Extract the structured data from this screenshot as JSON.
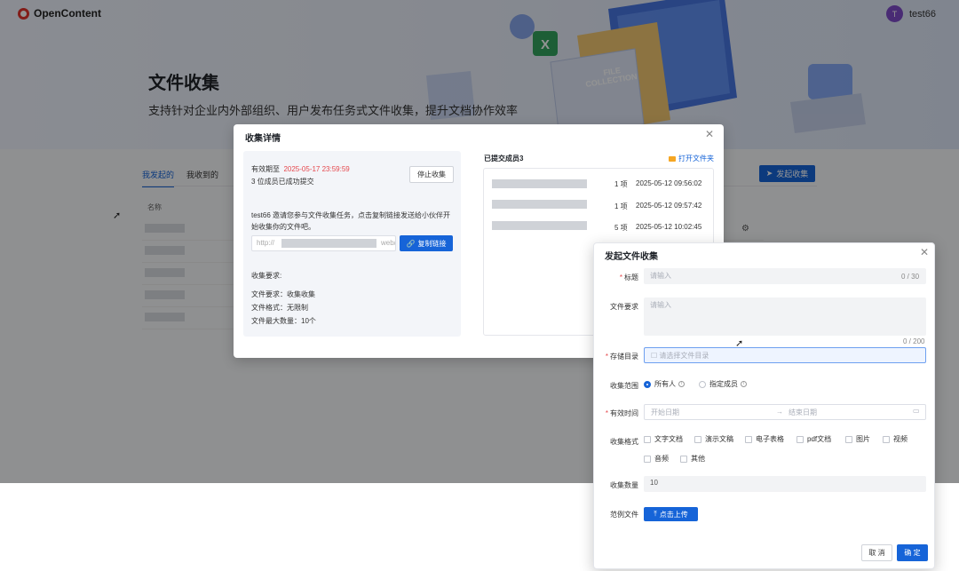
{
  "app": {
    "brand": "OpenContent",
    "user_name": "test66",
    "user_initial": "T"
  },
  "hero": {
    "title": "文件收集",
    "subtitle": "支持针对企业内外部组织、用户发布任务式文件收集，提升文档协作效率"
  },
  "hero_art": {
    "badge_line1": "FILE",
    "badge_line2": "COLLECTION",
    "excel_letter": "X"
  },
  "list": {
    "tabs": [
      "我发起的",
      "我收到的"
    ],
    "active_tab": "我发起的",
    "start_button": "发起收集",
    "column_name": "名称"
  },
  "detail_dialog": {
    "title": "收集详情",
    "deadline_label": "有效期至",
    "deadline_value": "2025-05-17 23:59:59",
    "submitted_summary": "3 位成员已成功提交",
    "stop_button": "停止收集",
    "invite_text_line1": "test66 邀请您参与文件收集任务，点击复制链接发送给小伙伴开",
    "invite_text_line2": "始收集你的文件吧。",
    "link_prefix": "http://",
    "link_suffix": "web/c",
    "copy_button": "复制链接",
    "requirements_title": "收集要求:",
    "req_file": "文件要求：收集收集",
    "req_format": "文件格式：无限制",
    "req_max": "文件最大数量：10个",
    "submitted_title": "已提交成员3",
    "open_folder": "打开文件夹",
    "submissions": [
      {
        "count": "1 项",
        "time": "2025-05-12 09:56:02"
      },
      {
        "count": "1 项",
        "time": "2025-05-12 09:57:42"
      },
      {
        "count": "5 项",
        "time": "2025-05-12 10:02:45"
      }
    ]
  },
  "start_dialog": {
    "title": "发起文件收集",
    "title_label": "标题",
    "title_placeholder": "请输入",
    "title_counter": "0 / 30",
    "req_label": "文件要求",
    "req_placeholder": "请输入",
    "req_counter": "0 / 200",
    "dir_label": "存储目录",
    "dir_placeholder": "请选择文件目录",
    "scope_label": "收集范围",
    "scope_all": "所有人",
    "scope_members": "指定成员",
    "time_label": "有效时间",
    "start_date_placeholder": "开始日期",
    "end_date_placeholder": "结束日期",
    "format_label": "收集格式",
    "formats": [
      "文字文档",
      "演示文稿",
      "电子表格",
      "pdf文档",
      "图片",
      "视频",
      "音频",
      "其他"
    ],
    "quantity_label": "收集数量",
    "quantity_value": "10",
    "sample_label": "范例文件",
    "upload_button": "点击上传",
    "cancel_button": "取 消",
    "ok_button": "确 定"
  },
  "colors": {
    "primary": "#1664d8",
    "danger": "#e5484d",
    "avatar": "#7f4bc9"
  }
}
